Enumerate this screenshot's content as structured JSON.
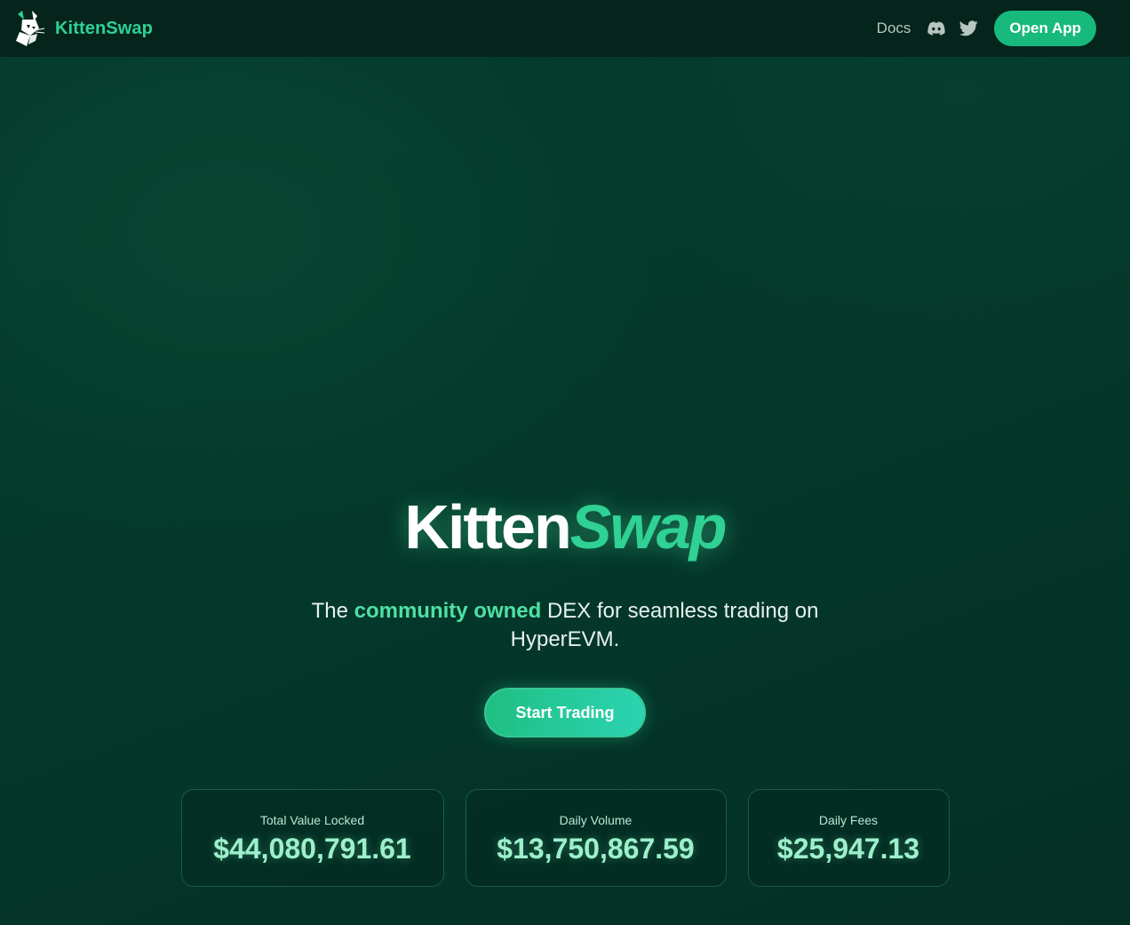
{
  "header": {
    "brand_name": "KittenSwap",
    "logo_icon": "cat-logo-icon",
    "nav": {
      "docs_label": "Docs",
      "discord_icon": "discord-icon",
      "twitter_icon": "twitter-icon"
    },
    "open_app_label": "Open App"
  },
  "hero": {
    "title_part1": "Kitten",
    "title_part2": "Swap",
    "tagline_prefix": "The ",
    "tagline_highlight": "community owned",
    "tagline_suffix": " DEX for seamless trading on HyperEVM.",
    "cta_label": "Start Trading"
  },
  "stats": [
    {
      "label": "Total Value Locked",
      "value": "$44,080,791.61"
    },
    {
      "label": "Daily Volume",
      "value": "$13,750,867.59"
    },
    {
      "label": "Daily Fees",
      "value": "$25,947.13"
    }
  ],
  "colors": {
    "accent": "#2fd194",
    "button": "#18b97d",
    "header_bg": "#04241c",
    "page_bg": "#053a2c"
  }
}
